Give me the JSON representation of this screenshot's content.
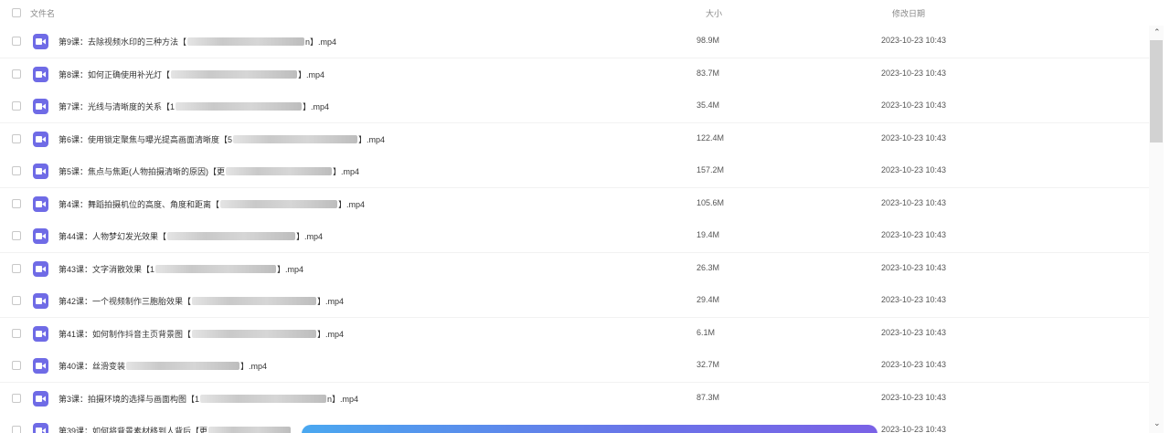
{
  "header": {
    "name_label": "文件名",
    "size_label": "大小",
    "date_label": "修改日期"
  },
  "files": [
    {
      "pre": "第9课：去除视频水印的三种方法【",
      "post": "n】.mp4",
      "size": "98.9M",
      "date": "2023-10-23 10:43"
    },
    {
      "pre": "第8课：如何正确使用补光灯【",
      "post": "】.mp4",
      "size": "83.7M",
      "date": "2023-10-23 10:43"
    },
    {
      "pre": "第7课：光线与清晰度的关系【1",
      "post": "】.mp4",
      "size": "35.4M",
      "date": "2023-10-23 10:43"
    },
    {
      "pre": "第6课：使用锁定聚焦与曝光提高画面清晰度【5",
      "post": "】.mp4",
      "size": "122.4M",
      "date": "2023-10-23 10:43"
    },
    {
      "pre": "第5课：焦点与焦距(人物拍摄清晰的原因)【更",
      "post": "】.mp4",
      "size": "157.2M",
      "date": "2023-10-23 10:43"
    },
    {
      "pre": "第4课：舞蹈拍摄机位的高度、角度和距离【",
      "post": "】.mp4",
      "size": "105.6M",
      "date": "2023-10-23 10:43"
    },
    {
      "pre": "第44课：人物梦幻发光效果【",
      "post": "】.mp4",
      "size": "19.4M",
      "date": "2023-10-23 10:43"
    },
    {
      "pre": "第43课：文字消散效果【1",
      "post": "】.mp4",
      "size": "26.3M",
      "date": "2023-10-23 10:43"
    },
    {
      "pre": "第42课：一个视频制作三胞胎效果【",
      "post": "】.mp4",
      "size": "29.4M",
      "date": "2023-10-23 10:43"
    },
    {
      "pre": "第41课：如何制作抖音主页背景图【",
      "post": "】.mp4",
      "size": "6.1M",
      "date": "2023-10-23 10:43"
    },
    {
      "pre": "第40课：丝滑变装",
      "post": "】.mp4",
      "size": "32.7M",
      "date": "2023-10-23 10:43"
    },
    {
      "pre": "第3课：拍摄环境的选择与画面构图【1",
      "post": "n】.mp4",
      "size": "87.3M",
      "date": "2023-10-23 10:43"
    },
    {
      "pre": "第39课：如何将背景素材移到人背后【更",
      "post": "",
      "size": "",
      "date": "2023-10-23 10:43"
    }
  ],
  "colors": {
    "video_icon": "#6f6be6",
    "accent_bar_start": "#4aa8f0",
    "accent_bar_end": "#7a62e6"
  },
  "icons": {
    "file_type": "video-camera-icon",
    "scroll_up": "chevron-up-icon",
    "scroll_down": "chevron-down-icon"
  }
}
